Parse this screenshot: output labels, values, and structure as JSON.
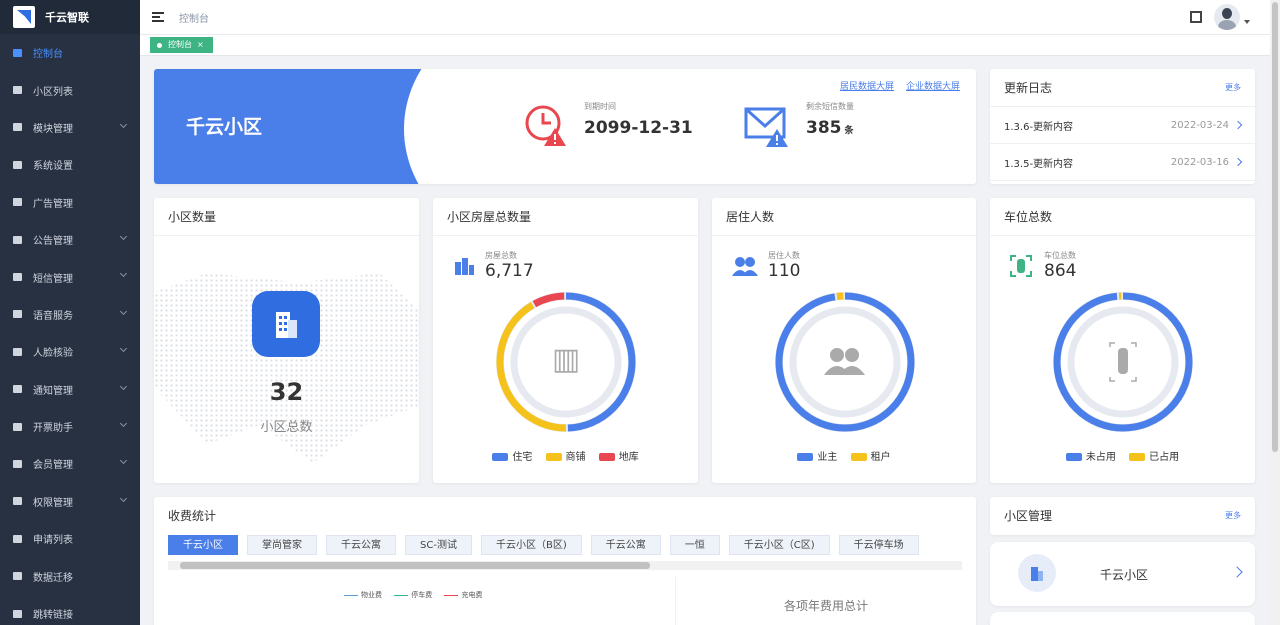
{
  "brand": {
    "name": "千云智联"
  },
  "sidebar": {
    "items": [
      {
        "label": "控制台",
        "active": true,
        "icon": "monitor-icon",
        "arrow": false
      },
      {
        "label": "小区列表",
        "icon": "building-icon",
        "arrow": false
      },
      {
        "label": "模块管理",
        "icon": "grid-icon",
        "arrow": true
      },
      {
        "label": "系统设置",
        "icon": "gears-icon",
        "arrow": false
      },
      {
        "label": "广告管理",
        "icon": "arrows-icon",
        "arrow": false
      },
      {
        "label": "公告管理",
        "icon": "send-icon",
        "arrow": true
      },
      {
        "label": "短信管理",
        "icon": "envelope-icon",
        "arrow": true
      },
      {
        "label": "语音服务",
        "icon": "chat-icon",
        "arrow": true
      },
      {
        "label": "人脸核验",
        "icon": "shield-icon",
        "arrow": true
      },
      {
        "label": "通知管理",
        "icon": "envelope-icon",
        "arrow": true
      },
      {
        "label": "开票助手",
        "icon": "grid-icon",
        "arrow": true
      },
      {
        "label": "会员管理",
        "icon": "user-icon",
        "arrow": true
      },
      {
        "label": "权限管理",
        "icon": "key-icon",
        "arrow": true
      },
      {
        "label": "申请列表",
        "icon": "file-icon",
        "arrow": false
      },
      {
        "label": "数据迁移",
        "icon": "grid-icon",
        "arrow": false
      },
      {
        "label": "跳转链接",
        "icon": "external-link-icon",
        "arrow": false
      }
    ]
  },
  "header": {
    "breadcrumb": "控制台"
  },
  "tags": {
    "active_tag": "控制台",
    "close": "×"
  },
  "banner": {
    "community_name": "千云小区",
    "link1": "居民数据大屏",
    "link2": "企业数据大屏",
    "expire_label": "到期时间",
    "expire_value": "2099-12-31",
    "sms_label": "剩余短信数量",
    "sms_value": "385",
    "sms_unit": "条"
  },
  "changelog": {
    "title": "更新日志",
    "more": "更多",
    "entries": [
      {
        "title": "1.3.6-更新内容",
        "date": "2022-03-24"
      },
      {
        "title": "1.3.5-更新内容",
        "date": "2022-03-16"
      }
    ]
  },
  "stats": {
    "community": {
      "title": "小区数量",
      "count": "32",
      "label": "小区总数"
    },
    "houses": {
      "title": "小区房屋总数量",
      "label": "房屋总数",
      "value": "6,717",
      "legend": [
        "住宅",
        "商铺",
        "地库"
      ],
      "colors": [
        "#4a7ee8",
        "#f5c21b",
        "#e8474f"
      ],
      "shares": [
        0.5,
        0.42,
        0.08
      ]
    },
    "residents": {
      "title": "居住人数",
      "label": "居住人数",
      "value": "110",
      "legend": [
        "业主",
        "租户"
      ],
      "colors": [
        "#4a7ee8",
        "#f5c21b"
      ],
      "shares": [
        0.98,
        0.02
      ]
    },
    "parking": {
      "title": "车位总数",
      "label": "车位总数",
      "value": "864",
      "legend": [
        "未占用",
        "已占用"
      ],
      "colors": [
        "#4a7ee8",
        "#f5c21b"
      ],
      "shares": [
        0.99,
        0.01
      ]
    }
  },
  "fees": {
    "title": "收费统计",
    "tabs": [
      "千云小区",
      "掌尚管家",
      "千云公寓",
      "SC-测试",
      "千云小区（B区)",
      "千云公寓",
      "一恒",
      "千云小区（C区)",
      "千云停车场"
    ],
    "legend": [
      {
        "label": "物业费",
        "color": "#5b9bd5"
      },
      {
        "label": "停车费",
        "color": "#3eb383"
      },
      {
        "label": "充电费",
        "color": "#e8474f"
      }
    ],
    "total_label": "各项年费用总计"
  },
  "management": {
    "title": "小区管理",
    "more": "更多",
    "item": "千云小区"
  }
}
